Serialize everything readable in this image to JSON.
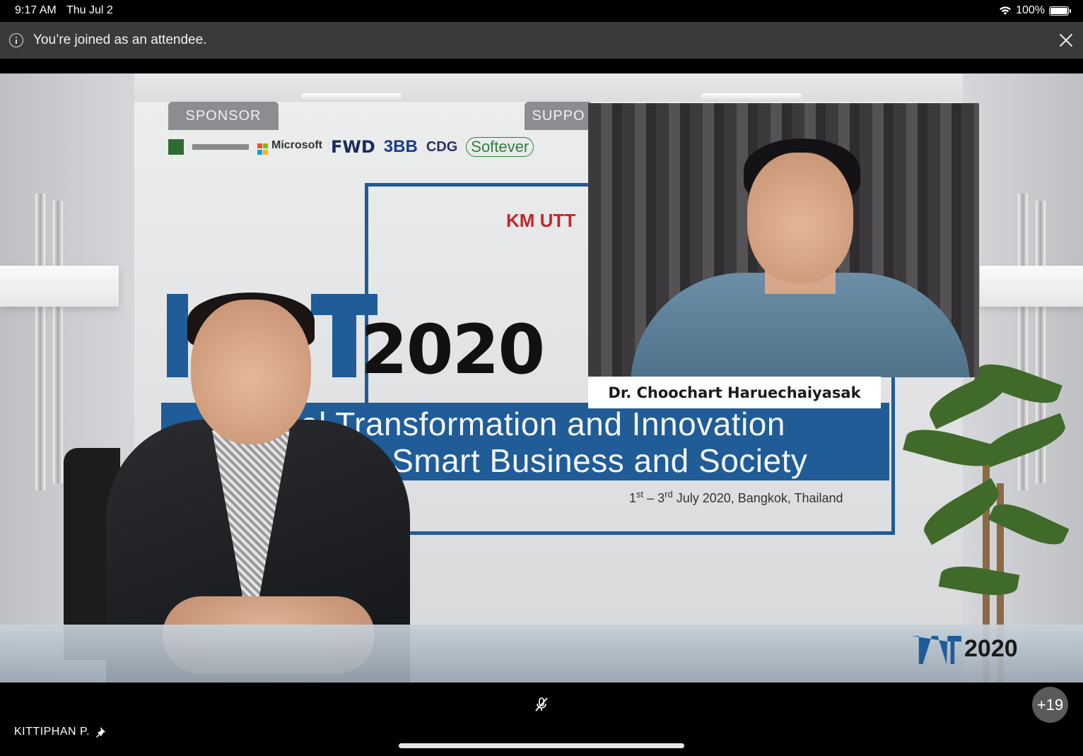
{
  "status_bar": {
    "time": "9:17 AM",
    "date": "Thu Jul 2",
    "battery": "100%",
    "battery_level": 1.0,
    "wifi_icon": "wifi-icon"
  },
  "notice": {
    "text": "You’re joined as an attendee.",
    "info_icon": "info-icon",
    "close_icon": "close-icon"
  },
  "stage": {
    "sponsor_tab": "SPONSOR",
    "support_tab": "SUPPO",
    "sponsors": [
      "Microsoft",
      "FWD",
      "3BB",
      "CDG",
      "Softever"
    ],
    "org_logo": "KM UTT",
    "event_year": "2020",
    "banner_line1": "al Transformation and Innovation",
    "banner_line2": "r Smart Business and Society",
    "dates_prefix": "1",
    "dates_sup1": "st",
    "dates_mid": " – 3",
    "dates_sup2": "rd",
    "dates_suffix": " July 2020, Bangkok, Thailand",
    "floor_logo_year": "2020",
    "accent_color": "#1f5c98"
  },
  "participant_tile": {
    "name": "Dr. Choochart Haruechaiyasak"
  },
  "controls": {
    "mic_icon": "mic-muted-icon",
    "others_count": "+19",
    "self_name": "KITTIPHAN P.",
    "pin_icon": "pin-icon"
  }
}
